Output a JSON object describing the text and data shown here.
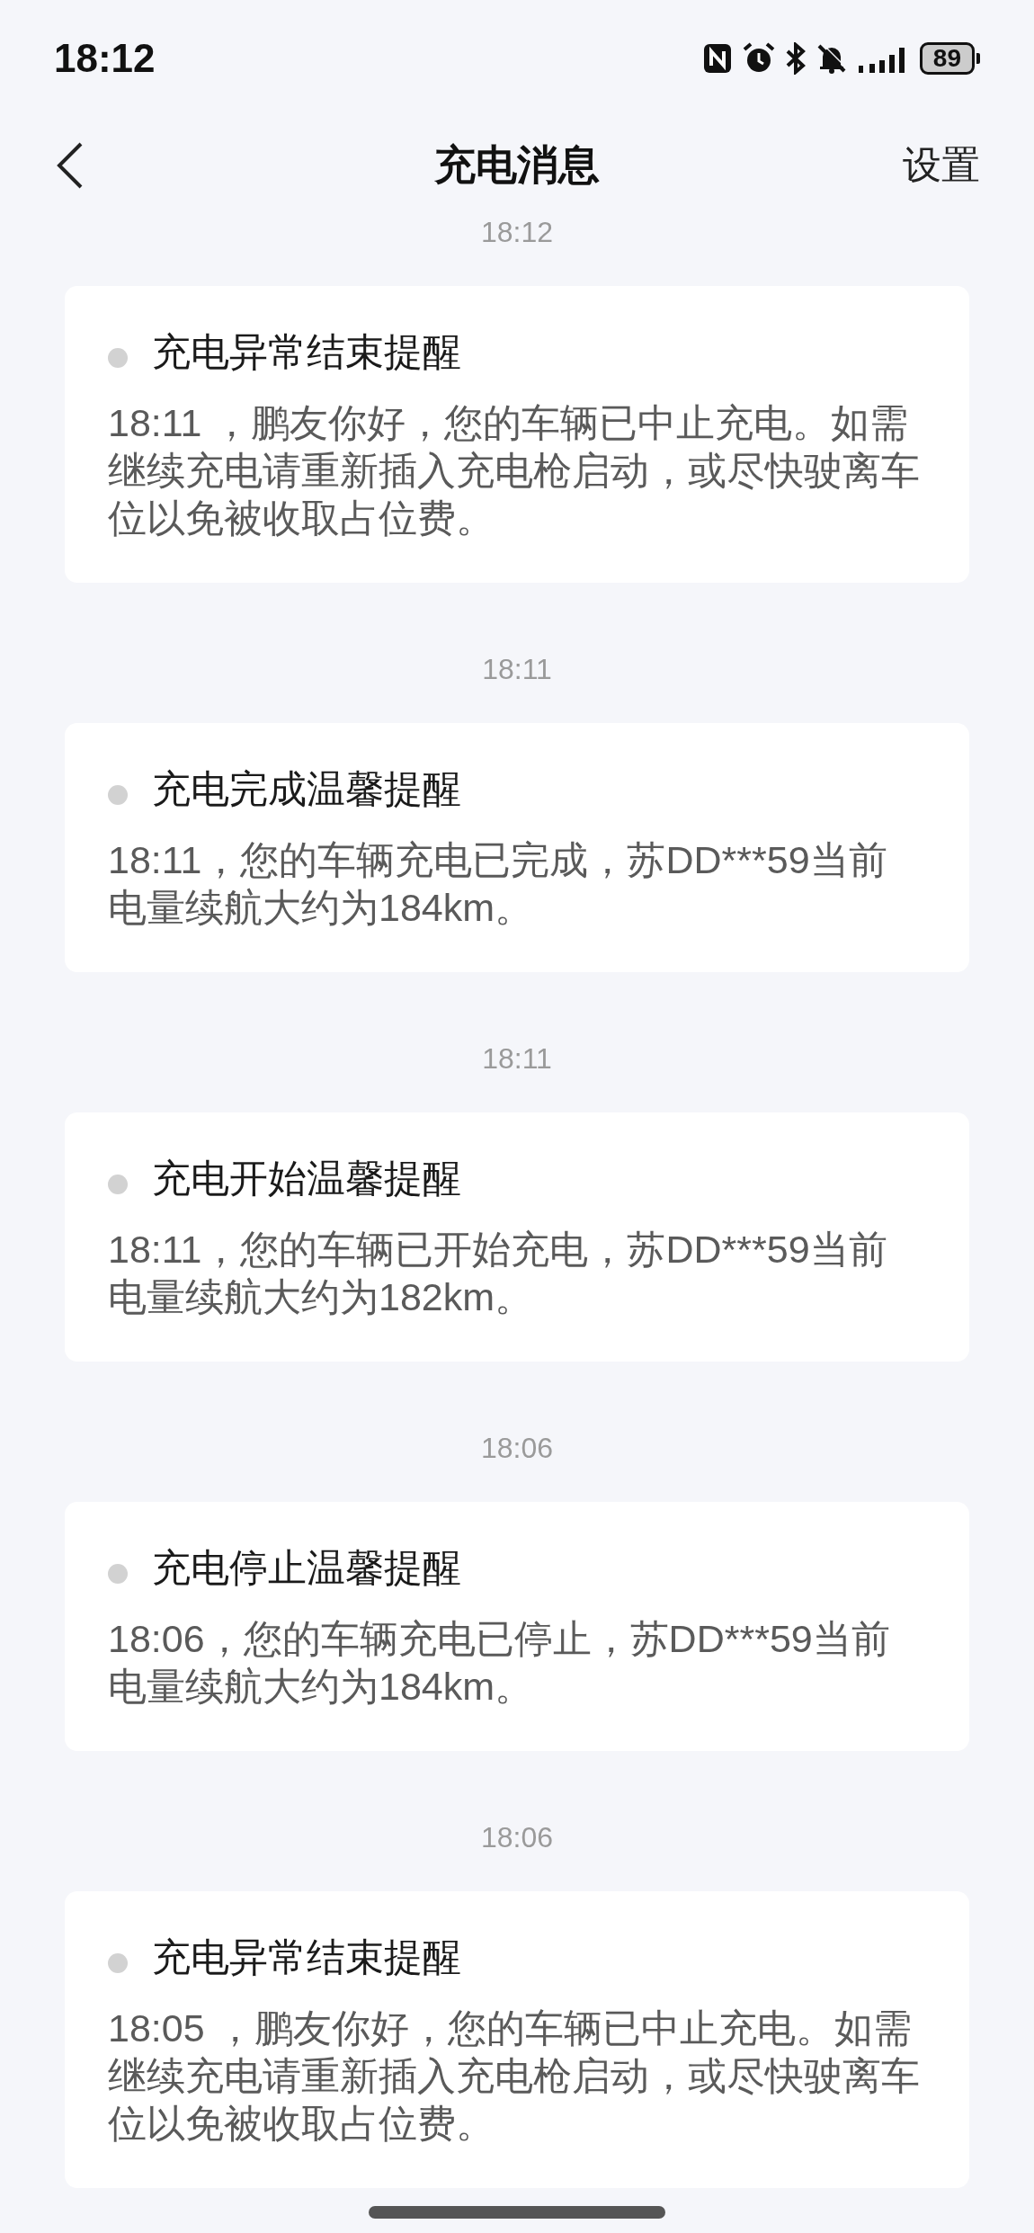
{
  "status_bar": {
    "time": "18:12",
    "battery": "89"
  },
  "header": {
    "title": "充电消息",
    "action": "设置"
  },
  "messages": [
    {
      "time": "18:12",
      "title": "充电异常结束提醒",
      "body": "18:11 ，鹏友你好，您的车辆已中止充电。如需继续充电请重新插入充电枪启动，或尽快驶离车位以免被收取占位费。"
    },
    {
      "time": "18:11",
      "title": "充电完成温馨提醒",
      "body": "18:11，您的车辆充电已完成，苏DD***59当前电量续航大约为184km。"
    },
    {
      "time": "18:11",
      "title": "充电开始温馨提醒",
      "body": "18:11，您的车辆已开始充电，苏DD***59当前电量续航大约为182km。"
    },
    {
      "time": "18:06",
      "title": "充电停止温馨提醒",
      "body": "18:06，您的车辆充电已停止，苏DD***59当前电量续航大约为184km。"
    },
    {
      "time": "18:06",
      "title": "充电异常结束提醒",
      "body": "18:05 ，鹏友你好，您的车辆已中止充电。如需继续充电请重新插入充电枪启动，或尽快驶离车位以免被收取占位费。"
    }
  ]
}
